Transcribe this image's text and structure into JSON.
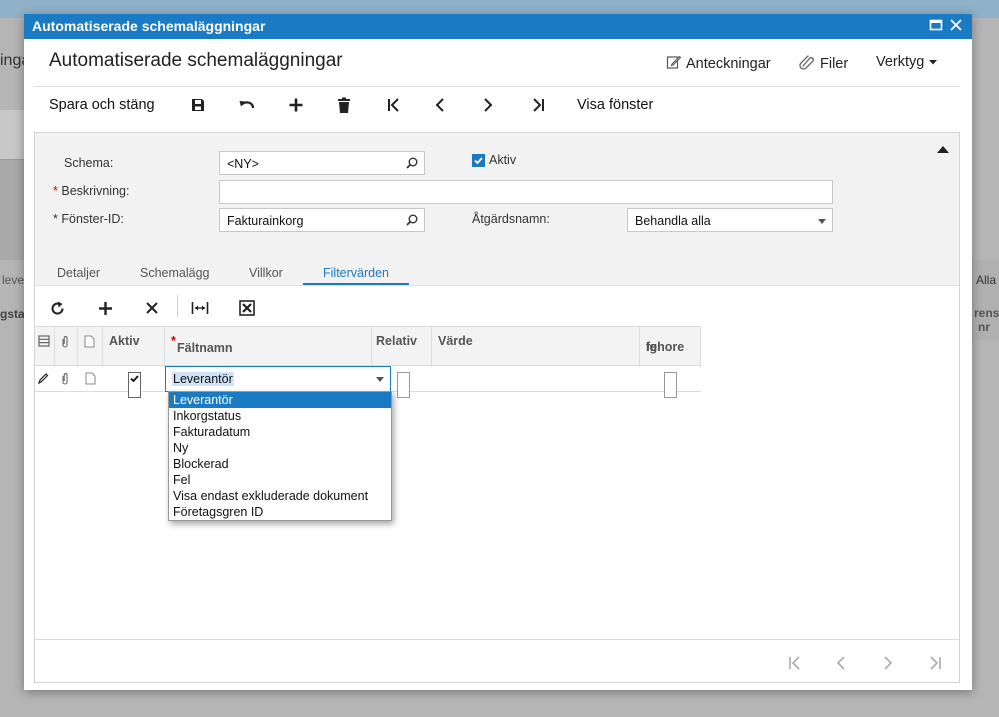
{
  "background": {
    "left_title": "inga",
    "left_text_1": "leve",
    "left_text_2": "gsta",
    "right_text_1": "Alla",
    "right_text_2": "rens",
    "right_text_3": "nr"
  },
  "dialog": {
    "title": "Automatiserade schemaläggningar",
    "page_title": "Automatiserade schemaläggningar",
    "header_links": {
      "notes": "Anteckningar",
      "files": "Filer",
      "tools": "Verktyg"
    },
    "toolbar": {
      "save_close": "Spara och stäng",
      "show_window": "Visa fönster"
    },
    "form": {
      "schema_label": "Schema:",
      "schema_value": "<NY>",
      "active_label": "Aktiv",
      "active_checked": true,
      "description_label": "Beskrivning:",
      "description_value": "",
      "window_id_label": "Fönster-ID:",
      "window_id_value": "Fakturainkorg",
      "action_label": "Åtgärdsnamn:",
      "action_value": "Behandla alla"
    },
    "tabs": [
      {
        "label": "Detaljer"
      },
      {
        "label": "Schemalägg"
      },
      {
        "label": "Villkor"
      },
      {
        "label": "Filtervärden"
      }
    ],
    "active_tab": "Filtervärden",
    "grid": {
      "columns": {
        "active": "Aktiv",
        "field_name": "Fältnamn",
        "relative": "Relativ",
        "value": "Värde",
        "ignore_error_1": "Ignore",
        "ignore_error_2": "fel"
      },
      "row": {
        "active": true,
        "field_name": "Leverantör",
        "relative": false,
        "value": "",
        "ignore_error": false
      }
    },
    "dropdown_options": [
      "Leverantör",
      "Inkorgstatus",
      "Fakturadatum",
      "Ny",
      "Blockerad",
      "Fel",
      "Visa endast exkluderade dokument",
      "Företagsgren ID"
    ],
    "dropdown_selected": "Leverantör"
  },
  "colors": {
    "accent": "#1a7bc4",
    "required": "#dd0000"
  }
}
